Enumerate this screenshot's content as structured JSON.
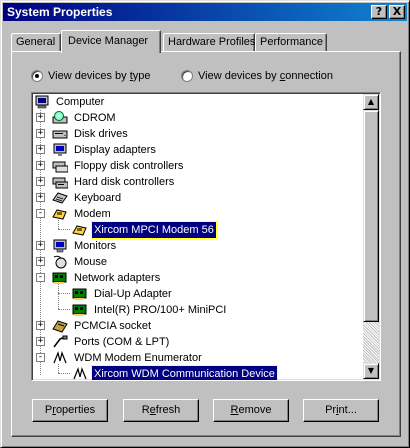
{
  "window": {
    "title": "System Properties",
    "help_glyph": "?",
    "close_glyph": "X"
  },
  "tabs": [
    {
      "label": "General"
    },
    {
      "label": "Device Manager",
      "active": true
    },
    {
      "label": "Hardware Profiles"
    },
    {
      "label": "Performance"
    }
  ],
  "view_options": {
    "by_type": {
      "pre": "View devices by ",
      "accel": "t",
      "post": "ype",
      "selected": true
    },
    "by_connection": {
      "pre": "View devices by ",
      "accel": "c",
      "post": "onnection",
      "selected": false
    }
  },
  "tree": {
    "root": {
      "label": "Computer",
      "icon": "computer-icon"
    },
    "items": [
      {
        "label": "CDROM",
        "icon": "cdrom-icon",
        "expander": "+"
      },
      {
        "label": "Disk drives",
        "icon": "disk-drive-icon",
        "expander": "+"
      },
      {
        "label": "Display adapters",
        "icon": "display-adapter-icon",
        "expander": "+"
      },
      {
        "label": "Floppy disk controllers",
        "icon": "floppy-controller-icon",
        "expander": "+"
      },
      {
        "label": "Hard disk controllers",
        "icon": "hard-disk-controller-icon",
        "expander": "+"
      },
      {
        "label": "Keyboard",
        "icon": "keyboard-icon",
        "expander": "+"
      },
      {
        "label": "Modem",
        "icon": "modem-icon",
        "expander": "-"
      },
      {
        "label": "Xircom MPCI Modem 56",
        "icon": "modem-device-icon",
        "child": true,
        "selected": true
      },
      {
        "label": "Monitors",
        "icon": "monitor-icon",
        "expander": "+"
      },
      {
        "label": "Mouse",
        "icon": "mouse-icon",
        "expander": "+"
      },
      {
        "label": "Network adapters",
        "icon": "network-adapter-icon",
        "expander": "-"
      },
      {
        "label": "Dial-Up Adapter",
        "icon": "network-card-icon",
        "child": true
      },
      {
        "label": "Intel(R) PRO/100+ MiniPCI",
        "icon": "network-card-icon",
        "child": true
      },
      {
        "label": "PCMCIA socket",
        "icon": "pcmcia-icon",
        "expander": "+"
      },
      {
        "label": "Ports (COM & LPT)",
        "icon": "port-icon",
        "expander": "+"
      },
      {
        "label": "WDM Modem Enumerator",
        "icon": "wdm-enumerator-icon",
        "expander": "-"
      },
      {
        "label": "Xircom WDM Communication Device",
        "icon": "wdm-device-icon",
        "child": true,
        "selected": true
      }
    ]
  },
  "buttons": {
    "properties": {
      "pre": "P",
      "accel": "r",
      "post": "operties"
    },
    "refresh": {
      "pre": "R",
      "accel": "e",
      "post": "fresh"
    },
    "remove": {
      "pre": "",
      "accel": "R",
      "post": "emove"
    },
    "print": {
      "pre": "Pr",
      "accel": "i",
      "post": "nt..."
    }
  },
  "colors": {
    "titlebar": "#000080",
    "selection": "#000080",
    "face": "#c0c0c0"
  }
}
